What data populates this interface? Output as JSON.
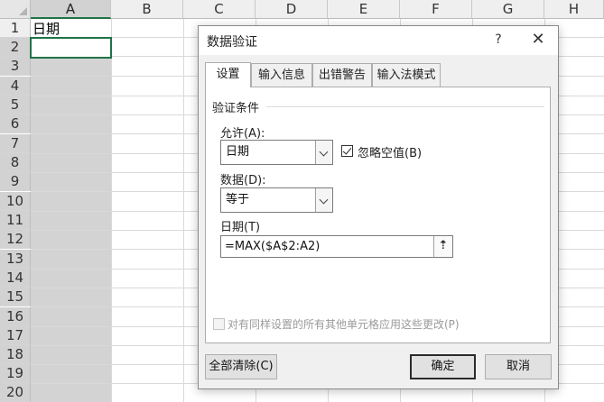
{
  "sheet": {
    "columns": [
      "A",
      "B",
      "C",
      "D",
      "E",
      "F",
      "G",
      "H"
    ],
    "rows": [
      "1",
      "2",
      "3",
      "4",
      "5",
      "6",
      "7",
      "8",
      "9",
      "10",
      "11",
      "12",
      "13",
      "14",
      "15",
      "16",
      "17",
      "18",
      "19",
      "20"
    ],
    "cell_a1": "日期"
  },
  "dialog": {
    "title": "数据验证",
    "help_label": "?",
    "close_label": "✕",
    "tabs": [
      "设置",
      "输入信息",
      "出错警告",
      "输入法模式"
    ],
    "group_label": "验证条件",
    "allow_label": "允许(A):",
    "allow_value": "日期",
    "ignore_blank_label": "忽略空值(B)",
    "data_label": "数据(D):",
    "data_value": "等于",
    "date_label": "日期(T)",
    "formula_value": "=MAX($A$2:A2)",
    "apply_all_label": "对有同样设置的所有其他单元格应用这些更改(P)",
    "clear_all_label": "全部清除(C)",
    "ok_label": "确定",
    "cancel_label": "取消"
  },
  "colors": {
    "accent": "#217346",
    "selection_gray": "#d3d3d3"
  }
}
